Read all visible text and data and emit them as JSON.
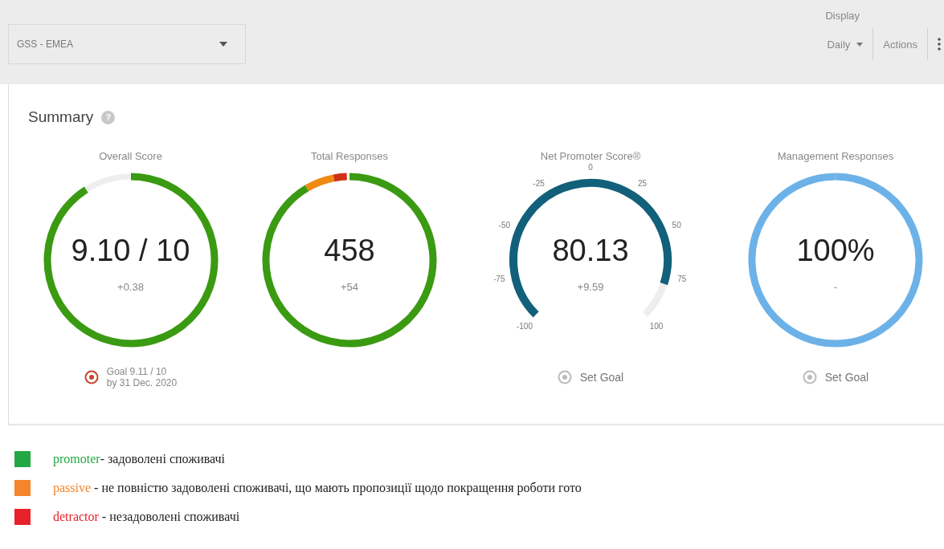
{
  "toolbar": {
    "selector": {
      "value": "GSS - EMEA"
    },
    "display_label": "Display",
    "period": {
      "value": "Daily"
    },
    "actions": "Actions"
  },
  "summary": {
    "title": "Summary",
    "help": "?",
    "gauges": [
      {
        "kind": "ring",
        "title": "Overall Score",
        "value": "9.10 / 10",
        "change": "+0.38",
        "goal": {
          "set": true,
          "text": "Goal 9.11 / 10",
          "date": "by 31 Dec. 2020"
        }
      },
      {
        "kind": "segmented",
        "title": "Total Responses",
        "value": "458",
        "change": "+54",
        "segments": [
          {
            "color": "#3a9a12"
          },
          {
            "color": "#ef8a12"
          },
          {
            "color": "#d03018"
          }
        ]
      },
      {
        "kind": "dial",
        "title": "Net Promoter Score®",
        "value": "80.13",
        "change": "+9.59",
        "ticks": [
          "-100",
          "-75",
          "-50",
          "-25",
          "0",
          "25",
          "50",
          "75",
          "100"
        ],
        "goal": {
          "set": false,
          "text": "Set Goal"
        }
      },
      {
        "kind": "ring",
        "title": "Management Responses",
        "value": "100%",
        "change": "-",
        "goal": {
          "set": false,
          "text": "Set Goal"
        }
      }
    ]
  },
  "legend": [
    {
      "term": "promoter",
      "text": "- задоволені споживачі",
      "color": "#22a843"
    },
    {
      "term": "passive",
      "text": " - не повністю задоволені споживачі, що мають пропозиції щодо покращення роботи гото",
      "color": "#f5842a"
    },
    {
      "term": "detractor",
      "text": " - незадоволені споживачі",
      "color": "#e8202a"
    }
  ]
}
